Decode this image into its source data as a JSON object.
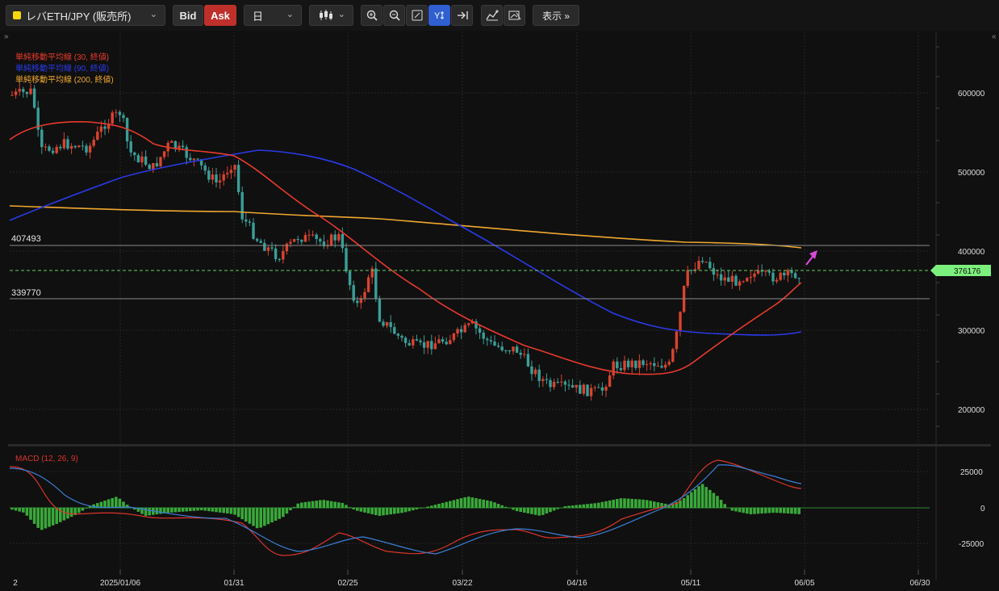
{
  "toolbar": {
    "symbol": "レバETH/JPY (販売所)",
    "bid_label": "Bid",
    "ask_label": "Ask",
    "period": "日",
    "display_label": "表示 »"
  },
  "icons": {
    "symbol_marker": "yellow-square",
    "candle_type": "candlestick-icon",
    "zoom_in": "zoom-in-icon",
    "zoom_out": "zoom-out-icon",
    "fit": "fit-icon",
    "auto_scale": "auto-scale-icon",
    "jump_latest": "jump-latest-icon",
    "indicator": "indicator-icon",
    "drawing": "drawing-icon"
  },
  "legend": {
    "ma30": "単純移動平均線 (30, 終値)",
    "ma90": "単純移動平均線 (90, 終値)",
    "ma200": "単純移動平均線 (200, 終値)",
    "macd": "MACD (12, 26, 9)"
  },
  "colors": {
    "ma30": "#e83a2c",
    "ma90": "#2a3ae6",
    "ma200": "#f0a830",
    "up": "#d9432f",
    "down": "#3a9e98",
    "macd_line": "#d9352b",
    "signal_line": "#3b7fd6",
    "histogram": "#3aa83a",
    "current_price": "#7cf07c"
  },
  "levels": {
    "upper": "407493",
    "lower": "339770",
    "current": "376176"
  },
  "chart_data": [
    {
      "type": "candlestick",
      "title": "",
      "x_ticks": [
        "2",
        "2025/01/06",
        "01/31",
        "02/25",
        "03/22",
        "04/16",
        "05/11",
        "06/05",
        "06/30"
      ],
      "y_ticks": [
        "600000",
        "500000",
        "400000",
        "300000",
        "200000"
      ],
      "ylim": [
        150000,
        650000
      ],
      "horizontal_lines": [
        407493,
        339770
      ],
      "current_price": 376176,
      "series": [
        {
          "name": "単純移動平均線 (30, 終値)",
          "values": [
            540000,
            562000,
            566000,
            565000,
            560000,
            520000,
            512000,
            470000,
            420000,
            375000,
            335000,
            300000,
            273000,
            250000,
            243000,
            250000,
            303000,
            350000,
            362000
          ]
        },
        {
          "name": "単純移動平均線 (90, 終値)",
          "values": [
            440000,
            470000,
            495000,
            510000,
            517000,
            525000,
            520000,
            508000,
            483000,
            435000,
            390000,
            348000,
            322000,
            306000,
            300000,
            297000,
            296000
          ]
        },
        {
          "name": "単純移動平均線 (200, 終値)",
          "values": [
            458000,
            455000,
            452000,
            450000,
            448000,
            441000,
            438000,
            433000,
            427000,
            420000,
            414000,
            408000,
            402000
          ]
        }
      ]
    },
    {
      "type": "macd",
      "title": "",
      "y_ticks": [
        "25000",
        "0",
        "-25000"
      ],
      "ylim": [
        -42000,
        38000
      ],
      "series": [
        {
          "name": "MACD",
          "values": [
            30000,
            20000,
            5000,
            -5000,
            -12000,
            -8000,
            -5000,
            -12000,
            -8000,
            -28000,
            -32000,
            -25000,
            -20000,
            -22000,
            -30000,
            -33000,
            -25000,
            -18000,
            -15000,
            -20000,
            -22000,
            -18000,
            -10000,
            0,
            2000,
            30000,
            32000,
            22000,
            15000
          ]
        },
        {
          "name": "Signal",
          "values": [
            28000,
            25000,
            15000,
            5000,
            -5000,
            -8000,
            -8000,
            -8000,
            -9000,
            -18000,
            -30000,
            -25000,
            -22000,
            -28000,
            -32000,
            -28000,
            -15000,
            -16000,
            -20000,
            -19000,
            -15000,
            -8000,
            0,
            5000,
            28000,
            25000,
            18000
          ]
        },
        {
          "name": "Histogram",
          "values": [
            -3000,
            -12000,
            -8000,
            2000,
            7000,
            -4000,
            -10000,
            -3000,
            4000,
            9000,
            3000,
            -5000,
            -4000,
            5000,
            8000,
            5000,
            2000,
            4000,
            8000,
            17000,
            10000,
            -2000,
            -4000,
            -3000
          ]
        }
      ]
    }
  ]
}
